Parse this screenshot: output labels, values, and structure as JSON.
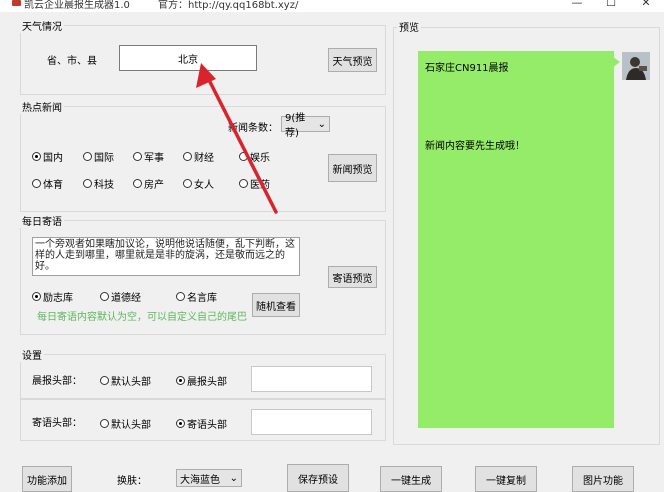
{
  "window": {
    "title": "凯云企业晨报生成器1.0",
    "site": "官方：http://qy.qq168bt.xyz/",
    "min": "—",
    "max": "☐",
    "close": "✕"
  },
  "weather": {
    "group_label": "天气情况",
    "region_label": "省、市、县",
    "region_value": "北京",
    "preview_button": "天气预览"
  },
  "news": {
    "group_label": "热点新闻",
    "count_label": "新闻条数：",
    "count_value": "9(推荐)",
    "categories": [
      {
        "label": "国内",
        "checked": true
      },
      {
        "label": "国际",
        "checked": false
      },
      {
        "label": "军事",
        "checked": false
      },
      {
        "label": "财经",
        "checked": false
      },
      {
        "label": "娱乐",
        "checked": false
      },
      {
        "label": "体育",
        "checked": false
      },
      {
        "label": "科技",
        "checked": false
      },
      {
        "label": "房产",
        "checked": false
      },
      {
        "label": "女人",
        "checked": false
      },
      {
        "label": "医药",
        "checked": false
      }
    ],
    "preview_button": "新闻预览"
  },
  "quote": {
    "group_label": "每日寄语",
    "text": "一个旁观者如果瞎加议论，说明他说话随便，乱下判断，这样的人走到哪里，哪里就是是非的旋涡，还是敬而远之的好。",
    "sources": [
      {
        "label": "励志库",
        "checked": true
      },
      {
        "label": "道德经",
        "checked": false
      },
      {
        "label": "名言库",
        "checked": false
      }
    ],
    "random_button": "随机查看",
    "hint": "每日寄语内容默认为空，可以自定义自己的尾巴",
    "preview_button": "寄语预览"
  },
  "settings": {
    "group_label": "设置",
    "morning_header": {
      "label": "晨报头部：",
      "options": [
        {
          "label": "默认头部",
          "checked": false
        },
        {
          "label": "晨报头部",
          "checked": true
        }
      ],
      "value": ""
    },
    "quote_header": {
      "label": "寄语头部：",
      "options": [
        {
          "label": "默认头部",
          "checked": false
        },
        {
          "label": "寄语头部",
          "checked": true
        }
      ],
      "value": ""
    }
  },
  "preview": {
    "group_label": "预览",
    "title_line": "石家庄CN911晨报",
    "body_line": "新闻内容要先生成哦！"
  },
  "bottom": {
    "add_button": "功能添加",
    "skin_label": "换肤：",
    "skin_value": "大海蓝色",
    "save_button": "保存预设",
    "generate_button": "一键生成",
    "copy_button": "一键复制",
    "image_button": "图片功能"
  },
  "colors": {
    "preview_bubble": "#95ec69",
    "hint_text": "#5cb85c",
    "annotation_arrow": "#d9232d"
  }
}
